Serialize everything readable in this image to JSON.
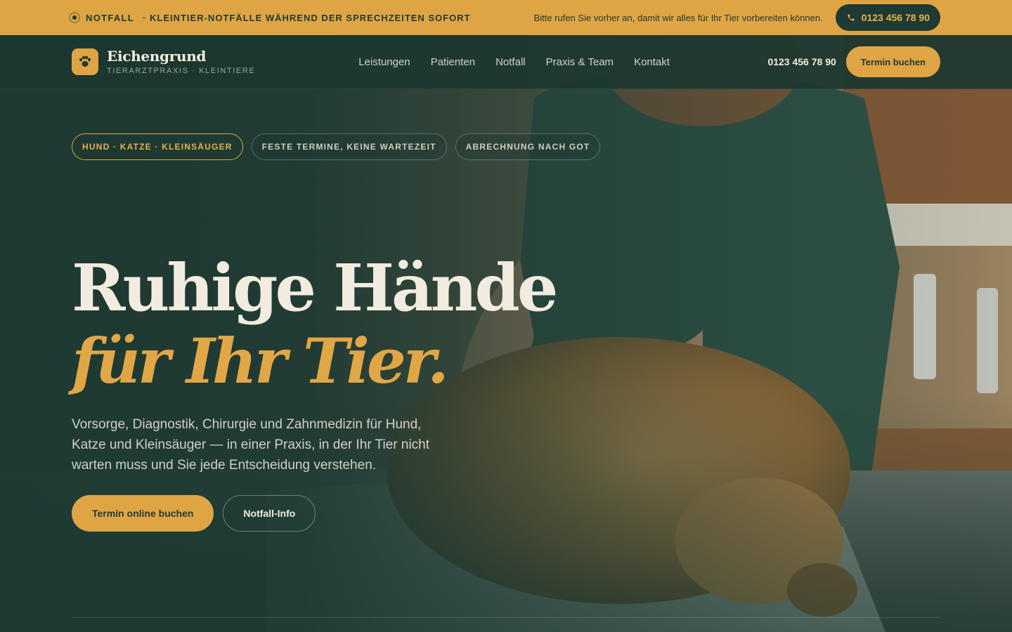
{
  "topbar": {
    "emergency_label": "NOTFALL",
    "emergency_text": "· KLEINTIER-NOTFÄLLE WÄHREND DER SPRECHZEITEN SOFORT",
    "note": "Bitte rufen Sie vorher an, damit wir alles für Ihr Tier vorbereiten können.",
    "phone": "0123 456 78 90"
  },
  "brand": {
    "name": "Eichengrund",
    "subtitle": "TIERARZTPRAXIS · KLEINTIERE",
    "logo_icon": "paw-icon"
  },
  "nav": {
    "items": [
      "Leistungen",
      "Patienten",
      "Notfall",
      "Praxis & Team",
      "Kontakt"
    ],
    "phone": "0123 456 78 90",
    "book_label": "Termin buchen"
  },
  "hero": {
    "chips": [
      "HUND · KATZE · KLEINSÄUGER",
      "FESTE TERMINE, KEINE WARTEZEIT",
      "ABRECHNUNG NACH GOT"
    ],
    "headline_line1": "Ruhige Hände",
    "headline_line2": "für Ihr Tier.",
    "lead": "Vorsorge, Diagnostik, Chirurgie und Zahnmedizin für Hund, Katze und Kleinsäuger — in einer Praxis, in der Ihr Tier nicht warten muss und Sie jede Entscheidung verstehen.",
    "cta_primary": "Termin online buchen",
    "cta_secondary": "Notfall-Info"
  },
  "colors": {
    "accent": "#dfa544",
    "dark_green": "#1e3a33",
    "cream": "#f1ecdf"
  }
}
